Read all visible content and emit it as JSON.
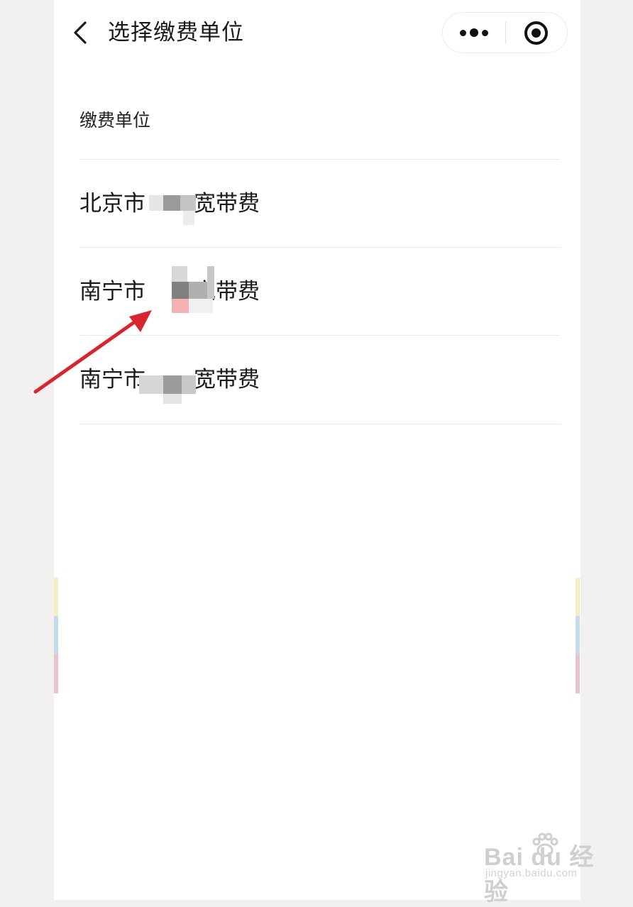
{
  "nav": {
    "title": "选择缴费单位"
  },
  "section": {
    "label": "缴费单位"
  },
  "units": [
    {
      "prefix": "北京市",
      "suffix": "宽带费"
    },
    {
      "prefix": "南宁市",
      "suffix": "宽带费"
    },
    {
      "prefix": "南宁市",
      "suffix": "宽带费"
    }
  ],
  "colors": {
    "background": "#f2f1ef",
    "page": "#ffffff",
    "text": "#1a1a1a",
    "divider": "#ececec",
    "arrow": "#d9232d"
  },
  "watermark": {
    "main": "Bai du 经验",
    "sub": "jingyan.baidu.com"
  }
}
